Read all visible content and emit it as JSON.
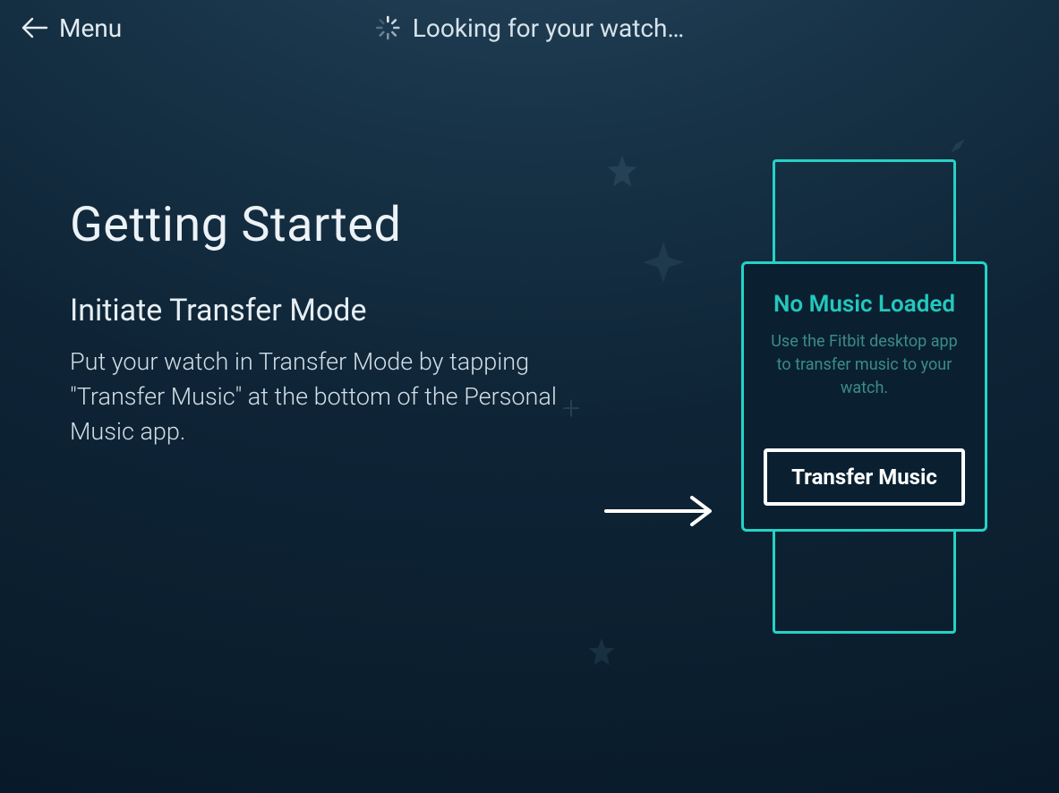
{
  "header": {
    "back_label": "Menu",
    "status_text": "Looking for your watch…"
  },
  "main": {
    "title": "Getting Started",
    "subtitle": "Initiate Transfer Mode",
    "body": "Put your watch in Transfer Mode by tapping \"Transfer Music\" at the bottom of the Personal Music app."
  },
  "watch": {
    "screen_title": "No Music Loaded",
    "screen_body": "Use the Fitbit desktop app to transfer music to your watch.",
    "button_label": "Transfer Music"
  }
}
